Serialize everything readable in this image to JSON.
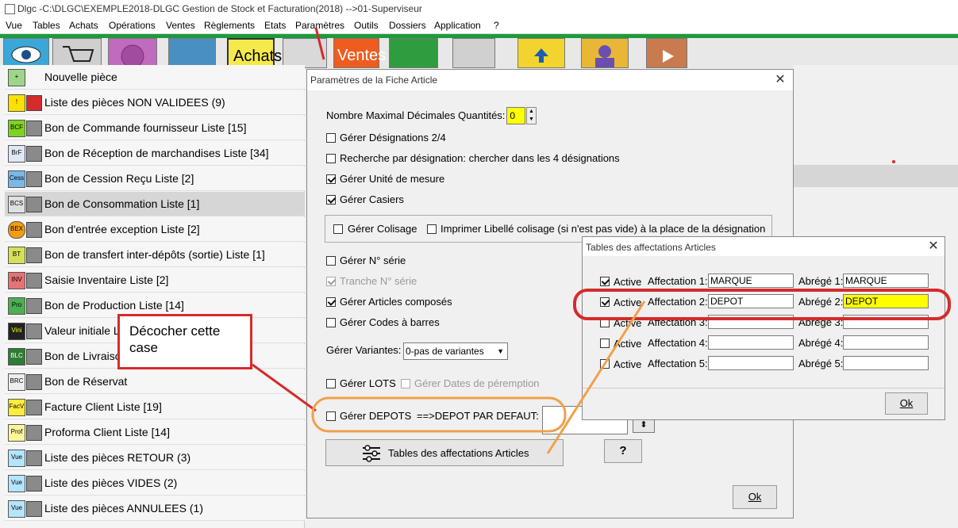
{
  "window": {
    "title": "Dlgc -C:\\DLGC\\EXEMPLE2018-DLGC Gestion de Stock et Facturation(2018) -->01-Superviseur"
  },
  "menu": [
    "Vue",
    "Tables",
    "Achats",
    "Opérations",
    "Ventes",
    "Règlements",
    "Etats",
    "Paramètres",
    "Outils",
    "Dossiers",
    "Application",
    "?"
  ],
  "toolbar": {
    "achats_label": "Achats",
    "ventes_label": "Ventes"
  },
  "left_list": [
    {
      "icon": "+",
      "label": "Nouvelle pièce"
    },
    {
      "icon": "!",
      "label": "Liste des pièces NON VALIDEES (9)"
    },
    {
      "icon": "BCF",
      "label": "Bon de Commande fournisseur Liste [15]"
    },
    {
      "icon": "BrF",
      "label": "Bon de Réception de marchandises Liste [34]"
    },
    {
      "icon": "Cess",
      "label": "Bon de Cession Reçu Liste [2]"
    },
    {
      "icon": "BCS",
      "label": "Bon de Consommation Liste [1]"
    },
    {
      "icon": "BEX",
      "label": "Bon d'entrée exception Liste [2]"
    },
    {
      "icon": "BT",
      "label": "Bon de transfert inter-dépôts (sortie) Liste [1]"
    },
    {
      "icon": "INV",
      "label": "Saisie Inventaire Liste [2]"
    },
    {
      "icon": "Pro",
      "label": "Bon de Production Liste [14]"
    },
    {
      "icon": "Vini",
      "label": "Valeur initiale Lis"
    },
    {
      "icon": "BLC",
      "label": "Bon de Livraison"
    },
    {
      "icon": "BRC",
      "label": "Bon de Réservat"
    },
    {
      "icon": "FacV",
      "label": "Facture Client Liste [19]"
    },
    {
      "icon": "Prof",
      "label": "Proforma Client Liste [14]"
    },
    {
      "icon": "Vue",
      "label": "Liste des pièces RETOUR (3)"
    },
    {
      "icon": "Vue",
      "label": "Liste des pièces VIDES (2)"
    },
    {
      "icon": "Vue",
      "label": "Liste des pièces ANNULEES (1)"
    }
  ],
  "dialog": {
    "title": "Paramètres de la Fiche Article",
    "max_dec_label": "Nombre Maximal Décimales Quantités:",
    "max_dec_value": "0",
    "opt_designations": "Gérer Désignations 2/4",
    "opt_recherche": "Recherche par désignation: chercher dans les 4 désignations",
    "opt_unite": "Gérer Unité de mesure",
    "opt_casiers": "Gérer Casiers",
    "opt_colisage": "Gérer Colisage",
    "opt_imprimer": "Imprimer Libellé colisage (si n'est pas vide) à la place de la désignation",
    "opt_serie": "Gérer N° série",
    "opt_tranche": "Tranche N° série",
    "opt_composes": "Gérer Articles composés",
    "opt_codes": "Gérer Codes à barres",
    "variantes_label": "Gérer Variantes:",
    "variantes_value": "0-pas de variantes",
    "opt_lots": "Gérer LOTS",
    "opt_peremption": "Gérer Dates de péremption",
    "opt_depots": "Gérer DEPOTS",
    "depot_defaut_label": "==>DEPOT PAR DEFAUT:",
    "tables_btn": "Tables des affectations Articles",
    "help_btn": "?",
    "ok_btn": "Ok"
  },
  "dialog2": {
    "title": "Tables des affectations Articles",
    "rows": [
      {
        "active": "Active",
        "aff_label": "Affectation 1:",
        "aff_value": "MARQUE",
        "abr_label": "Abrégé 1:",
        "abr_value": "MARQUE"
      },
      {
        "active": "Active",
        "aff_label": "Affectation 2:",
        "aff_value": "DEPOT",
        "abr_label": "Abrégé 2:",
        "abr_value": "DEPOT"
      },
      {
        "active": "Active",
        "aff_label": "Affectation 3:",
        "aff_value": "",
        "abr_label": "Abrégé 3:",
        "abr_value": ""
      },
      {
        "active": "Active",
        "aff_label": "Affectation 4:",
        "aff_value": "",
        "abr_label": "Abrégé 4:",
        "abr_value": ""
      },
      {
        "active": "Active",
        "aff_label": "Affectation 5:",
        "aff_value": "",
        "abr_label": "Abrégé 5:",
        "abr_value": ""
      }
    ],
    "ok_btn": "Ok"
  },
  "annotation": {
    "text": "Décocher cette case"
  },
  "colors": {
    "highlight_red": "#d62b2b",
    "highlight_orange": "#f0a04b",
    "field_yellow": "#ffff00",
    "green_bar": "#1d9a3d"
  }
}
